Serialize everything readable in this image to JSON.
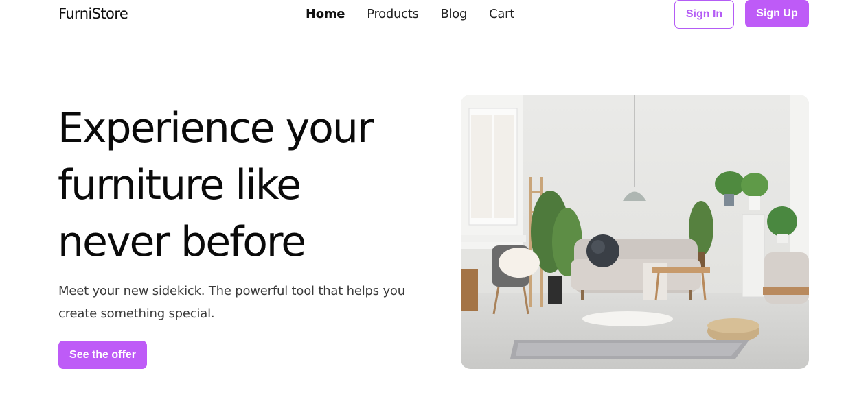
{
  "header": {
    "logo": "FurniStore",
    "nav": [
      {
        "label": "Home",
        "active": true
      },
      {
        "label": "Products",
        "active": false
      },
      {
        "label": "Blog",
        "active": false
      },
      {
        "label": "Cart",
        "active": false
      }
    ],
    "sign_in_label": "Sign In",
    "sign_up_label": "Sign Up"
  },
  "hero": {
    "title_lines": [
      "Experience your",
      "furniture like",
      "never before"
    ],
    "subtitle_lines": [
      "Meet your new sidekick. The powerful tool that helps you",
      "create something special."
    ],
    "cta_label": "See the offer"
  },
  "colors": {
    "accent": "#be5bf7",
    "text": "#0a0a0a",
    "background": "#ffffff"
  }
}
